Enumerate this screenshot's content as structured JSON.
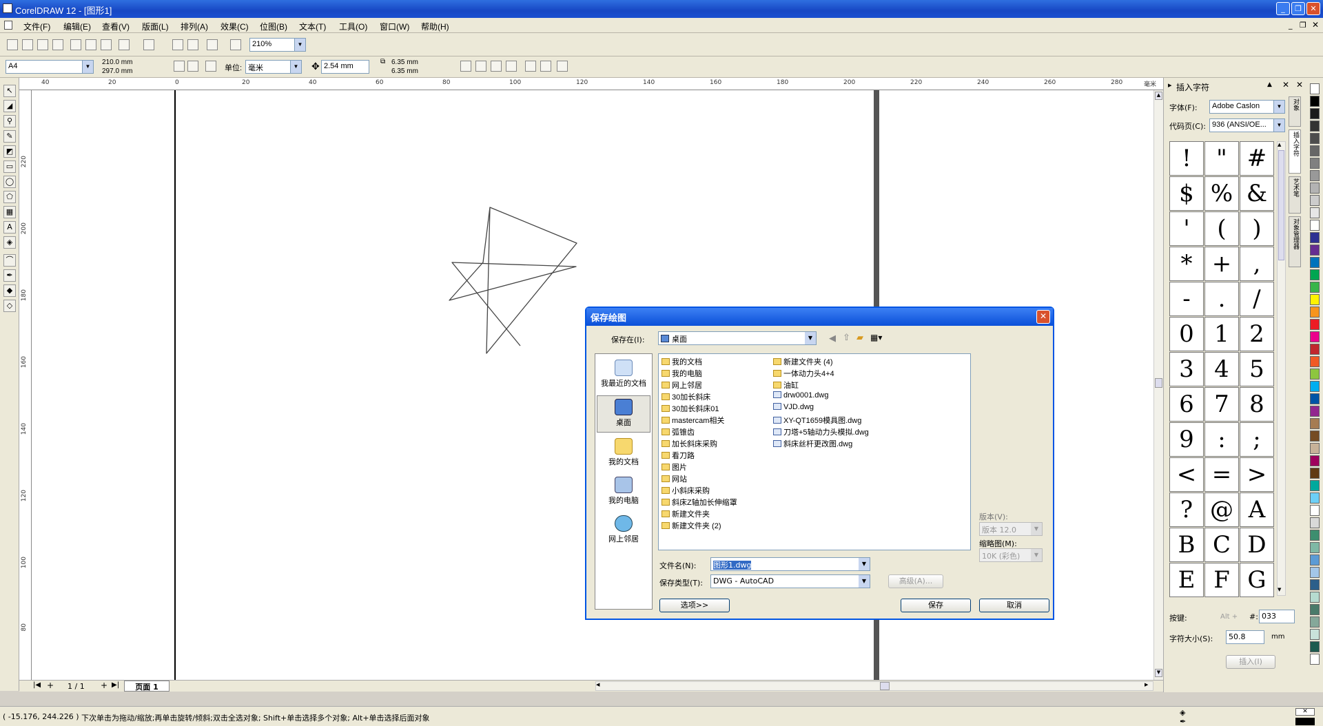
{
  "window": {
    "title": "CorelDRAW 12 - [图形1]"
  },
  "menu": [
    "文件(F)",
    "编辑(E)",
    "查看(V)",
    "版面(L)",
    "排列(A)",
    "效果(C)",
    "位图(B)",
    "文本(T)",
    "工具(O)",
    "窗口(W)",
    "帮助(H)"
  ],
  "toolbar": {
    "zoom": "210%"
  },
  "propertybar": {
    "paper_size": "A4",
    "width": "210.0 mm",
    "height": "297.0 mm",
    "unit_label": "单位:",
    "unit": "毫米",
    "nudge": "2.54 mm",
    "dup_x": "6.35 mm",
    "dup_y": "6.35 mm"
  },
  "ruler_h": [
    "40",
    "20",
    "0",
    "20",
    "40",
    "60",
    "80",
    "100",
    "120",
    "140",
    "160",
    "180",
    "200",
    "220",
    "240",
    "260",
    "280"
  ],
  "ruler_h_unit": "毫米",
  "ruler_v": [
    "220",
    "200",
    "180",
    "160",
    "140",
    "120",
    "100",
    "80"
  ],
  "pages": {
    "counter": "1 / 1",
    "tab": "页面 1"
  },
  "status": {
    "coords": "( -15.176, 244.226 )",
    "hint": "下次单击为拖动/缩放;再单击旋转/倾斜;双击全选对象; Shift+单击选择多个对象; Alt+单击选择后面对象"
  },
  "docker": {
    "title": "插入字符",
    "font_label": "字体(F):",
    "font": "Adobe Caslon",
    "codepage_label": "代码页(C):",
    "codepage": "936  (ANSI/OE...",
    "glyphs": [
      "!",
      "\"",
      "#",
      "$",
      "%",
      "&",
      "'",
      "(",
      ")",
      "*",
      "+",
      ",",
      "-",
      ".",
      "/",
      "0",
      "1",
      "2",
      "3",
      "4",
      "5",
      "6",
      "7",
      "8",
      "9",
      ":",
      ";",
      "<",
      "=",
      ">",
      "?",
      "@",
      "A",
      "B",
      "C",
      "D",
      "E",
      "F",
      "G"
    ],
    "keystroke_label": "按键:",
    "keystroke_prefix": "Alt +",
    "hash": "#:",
    "keystroke_value": "033",
    "size_label": "字符大小(S):",
    "size_value": "50.8",
    "size_unit": "mm",
    "insert": "插入(I)",
    "tabs": [
      "对象",
      "插入字符",
      "艺术笔",
      "对象管理器"
    ]
  },
  "palette": [
    "#ffffff",
    "#000000",
    "#1a1a1a",
    "#333333",
    "#4d4d4d",
    "#666666",
    "#808080",
    "#999999",
    "#b3b3b3",
    "#cccccc",
    "#e6e6e6",
    "#ffffff",
    "#2e3192",
    "#662d91",
    "#0072bc",
    "#00a651",
    "#39b54a",
    "#fff200",
    "#f7941d",
    "#ed1c24",
    "#ec008c",
    "#c1272d",
    "#f15a24",
    "#8dc63f",
    "#00aeef",
    "#0054a6",
    "#92278f",
    "#a67c52",
    "#754c24",
    "#c7b299",
    "#9e005d",
    "#603913",
    "#00a99d",
    "#6dcff6",
    "#ffffff",
    "#d9d9d9",
    "#3d8e6f",
    "#7fb8a5",
    "#5b9bd5",
    "#a3c6e8",
    "#2c5f8a",
    "#b6dbd0",
    "#4a7a6a",
    "#85a89a",
    "#c9e2da",
    "#1e5b4f",
    "#ffffff"
  ],
  "dialog": {
    "title": "保存绘图",
    "save_in_label": "保存在(I):",
    "save_in": "桌面",
    "places": [
      "我最近的文档",
      "桌面",
      "我的文档",
      "我的电脑",
      "网上邻居"
    ],
    "files_col1": [
      "我的文档",
      "我的电脑",
      "网上邻居",
      "30加长斜床",
      "30加长斜床01",
      "mastercam相关",
      "弧锥齿",
      "加长斜床采购",
      "看刀路",
      "图片",
      "网站",
      "小斜床采购",
      "斜床Z轴加长伸缩罩",
      "新建文件夹",
      "新建文件夹 (2)"
    ],
    "files_col2": [
      "新建文件夹 (4)",
      "一体动力头4+4",
      "油缸",
      "drw0001.dwg",
      "VJD.dwg",
      "XY-QT1659模具图.dwg",
      "刀塔+5轴动力头模拟.dwg",
      "斜床丝杆更改图.dwg"
    ],
    "version_label": "版本(V):",
    "version": "版本 12.0",
    "thumb_label": "缩略图(M):",
    "thumb": "10K (彩色)",
    "filename_label": "文件名(N):",
    "filename": "图形1.dwg",
    "filetype_label": "保存类型(T):",
    "filetype": "DWG - AutoCAD",
    "advanced": "高级(A)...",
    "options": "选项>>",
    "save": "保存",
    "cancel": "取消"
  }
}
